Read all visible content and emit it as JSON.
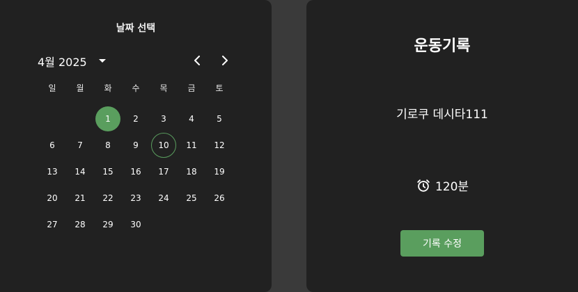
{
  "calendar": {
    "title": "날짜 선택",
    "month_label": "4월 2025",
    "weekdays": [
      "일",
      "월",
      "화",
      "수",
      "목",
      "금",
      "토"
    ],
    "days": [
      "",
      "",
      "1",
      "2",
      "3",
      "4",
      "5",
      "6",
      "7",
      "8",
      "9",
      "10",
      "11",
      "12",
      "13",
      "14",
      "15",
      "16",
      "17",
      "18",
      "19",
      "20",
      "21",
      "22",
      "23",
      "24",
      "25",
      "26",
      "27",
      "28",
      "29",
      "30"
    ],
    "selected_day": "1",
    "today_day": "10",
    "icons": {
      "month_dropdown": "caret-down-icon",
      "prev": "chevron-left-icon",
      "next": "chevron-right-icon"
    }
  },
  "record": {
    "title": "운동기록",
    "name": "기로쿠 데시타111",
    "duration": "120분",
    "duration_icon": "alarm-clock-icon",
    "edit_label": "기록 수정"
  },
  "colors": {
    "accent": "#5a9e5e",
    "panel_bg": "#212121",
    "page_bg": "#3a3a3a",
    "text": "#ffffff"
  }
}
